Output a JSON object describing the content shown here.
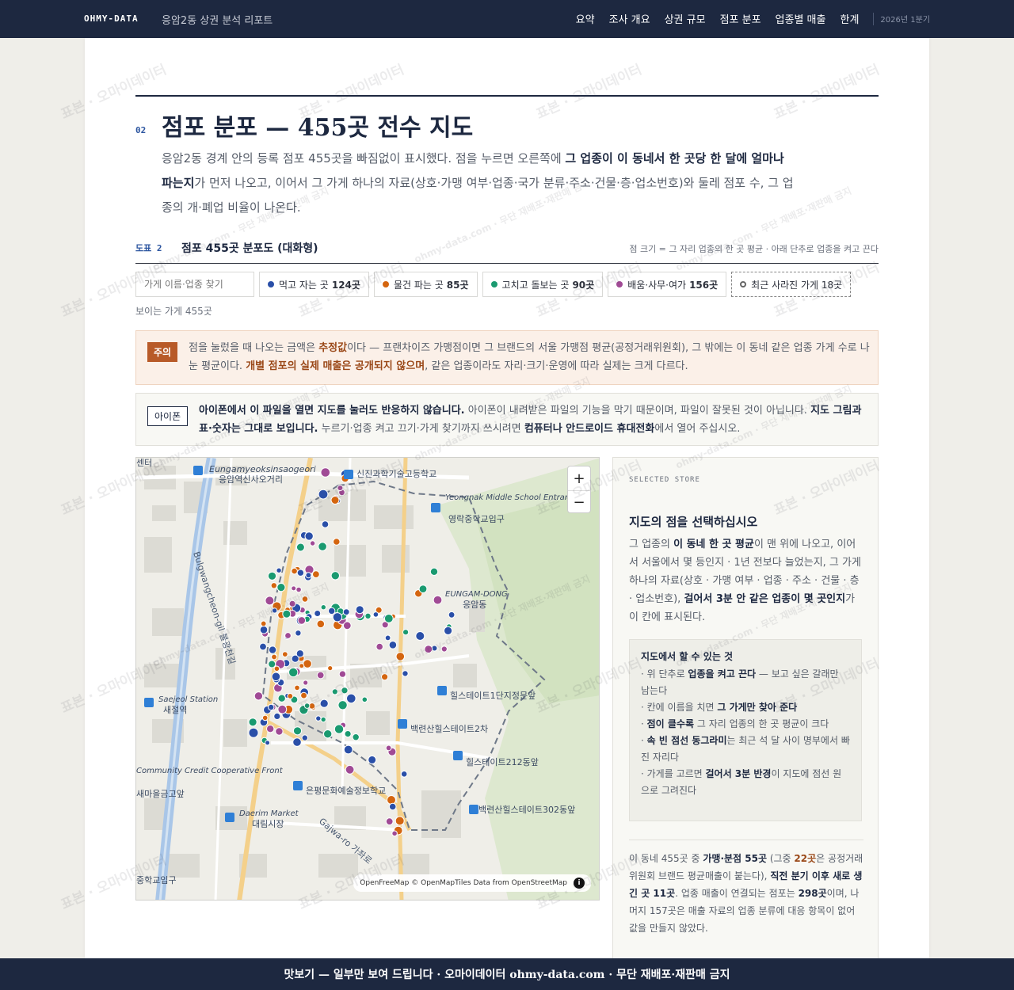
{
  "nav": {
    "brand": "OHMY-DATA",
    "subtitle": "응암2동 상권 분석 리포트",
    "links": [
      "요약",
      "조사 개요",
      "상권 규모",
      "점포 분포",
      "업종별 매출",
      "한계"
    ],
    "period": "2026년 1분기"
  },
  "section": {
    "number": "02",
    "title": "점포 분포 — 455곳 전수 지도",
    "lead_a": "응암2동 경계 안의 등록 점포 455곳을 빠짐없이 표시했다. 점을 누르면 오른쪽에 ",
    "lead_b": "그 업종이 이 동네서 한 곳당 한 달에 얼마나 파는지",
    "lead_c": "가 먼저 나오고, 이어서 그 가게 하나의 자료(상호·가맹 여부·업종·국가 분류·주소·건물·층·업소번호)와 둘레 점포 수, 그 업종의 개·폐업 비율이 나온다."
  },
  "figure": {
    "number": "도표 2",
    "title": "점포 455곳 분포도 (대화형)",
    "note": "점 크기 = 그 자리 업종의 한 곳 평균 · 아래 단추로 업종을 켜고 끈다"
  },
  "filters": {
    "search_placeholder": "가게 이름·업종 찾기",
    "chips": [
      {
        "label": "먹고 자는 곳",
        "count": "124곳",
        "color": "#2a4fa8"
      },
      {
        "label": "물건 파는 곳",
        "count": "85곳",
        "color": "#d4650f"
      },
      {
        "label": "고치고 돌보는 곳",
        "count": "90곳",
        "color": "#1a9a70"
      },
      {
        "label": "배움·사무·여가",
        "count": "156곳",
        "color": "#a04a95"
      }
    ],
    "closed": "최근 사라진 가게 18곳",
    "visible_count": "보이는 가게 455곳"
  },
  "caution": {
    "tag": "주의",
    "t1": "점을 눌렀을 때 나오는 금액은 ",
    "b1": "추정값",
    "t2": "이다 — 프랜차이즈 가맹점이면 그 브랜드의 서울 가맹점 평균(공정거래위원회), 그 밖에는 이 동네 같은 업종 가게 수로 나눈 평균이다. ",
    "b2": "개별 점포의 실제 매출은 공개되지 않으며",
    "t3": ", 같은 업종이라도 자리·크기·운영에 따라 실제는 크게 다르다."
  },
  "iphone": {
    "tag": "아이폰",
    "b1": "아이폰에서 이 파일을 열면 지도를 눌러도 반응하지 않습니다.",
    "t1": " 아이폰이 내려받은 파일의 기능을 막기 때문이며, 파일이 잘못된 것이 아닙니다. ",
    "b2": "지도 그림과 표·숫자는 그대로 보입니다.",
    "t2": " 누르기·업종 켜고 끄기·가게 찾기까지 쓰시려면 ",
    "b3": "컴퓨터나 안드로이드 휴대전화",
    "t3": "에서 열어 주십시오."
  },
  "map": {
    "zoom_in": "+",
    "zoom_out": "−",
    "attribution": "OpenFreeMap © OpenMapTiles Data from OpenStreetMap",
    "labels": [
      "Eungamyeoksinsaogeori",
      "응암역신사오거리",
      "신진과학기술고등학교",
      "Yeongnak Middle School Entrance",
      "영락중학교입구",
      "EUNGAM-DONG",
      "응암동",
      "Bulgwangcheon-gil 불광천길",
      "Saejeol Station",
      "새절역",
      "Community Credit Cooperative Front",
      "새마을금고앞",
      "힐스테이트1단지정문앞",
      "백련산힐스테이트2차",
      "힐스테이트212동앞",
      "은평문화예술정보학교",
      "Daerim Market",
      "대림시장",
      "백련산힐스테이트302동앞",
      "Gajwa-ro 가좌로",
      "중학교입구",
      "센터"
    ]
  },
  "panel": {
    "kicker": "SELECTED STORE",
    "title": "지도의 점을 선택하십시오",
    "d1": "그 업종의 ",
    "db1": "이 동네 한 곳 평균",
    "d2": "이 맨 위에 나오고, 이어서 서울에서 몇 등인지 · 1년 전보다 늘었는지, 그 가게 하나의 자료(상호 · 가맹 여부 · 업종 · 주소 · 건물 · 층 · 업소번호), ",
    "db2": "걸어서 3분 안 같은 업종이 몇 곳인지",
    "d3": "가 이 칸에 표시된다.",
    "box_title": "지도에서 할 수 있는 것",
    "box_items": [
      {
        "pre": "· 위 단추로 ",
        "b": "업종을 켜고 끈다",
        "post": " — 보고 싶은 갈래만 남는다"
      },
      {
        "pre": "· 칸에 이름을 치면 ",
        "b": "그 가게만 찾아 준다",
        "post": ""
      },
      {
        "pre": "· ",
        "b": "점이 클수록",
        "post": " 그 자리 업종의 한 곳 평균이 크다"
      },
      {
        "pre": "· ",
        "b": "속 빈 점선 동그라미",
        "post": "는 최근 석 달 사이 명부에서 빠진 자리다"
      },
      {
        "pre": "· 가게를 고르면 ",
        "b": "걸어서 3분 반경",
        "post": "이 지도에 점선 원으로 그려진다"
      }
    ],
    "s1": "이 동네 455곳 중 ",
    "sb1": "가맹·분점 55곳",
    "s2": " (그중 ",
    "sb2": "22곳",
    "s3": "은 공정거래위원회 브랜드 평균매출이 붙는다), ",
    "sb3": "직전 분기 이후 새로 생긴 곳 11곳",
    "s4": ". 업종 매출이 연결되는 점포는 ",
    "sb4": "298곳",
    "s5": "이며, 나머지 157곳은 매출 자료의 업종 분류에 대응 항목이 없어 값을 만들지 않았다."
  },
  "watermark": {
    "a": "표본 · 오마이데이터",
    "b": "ohmy-data.com · 무단 재배포·재판매 금지"
  },
  "footer": "맛보기 — 일부만 보여 드립니다 · 오마이데이터 ohmy-data.com · 무단 재배포·재판매 금지"
}
